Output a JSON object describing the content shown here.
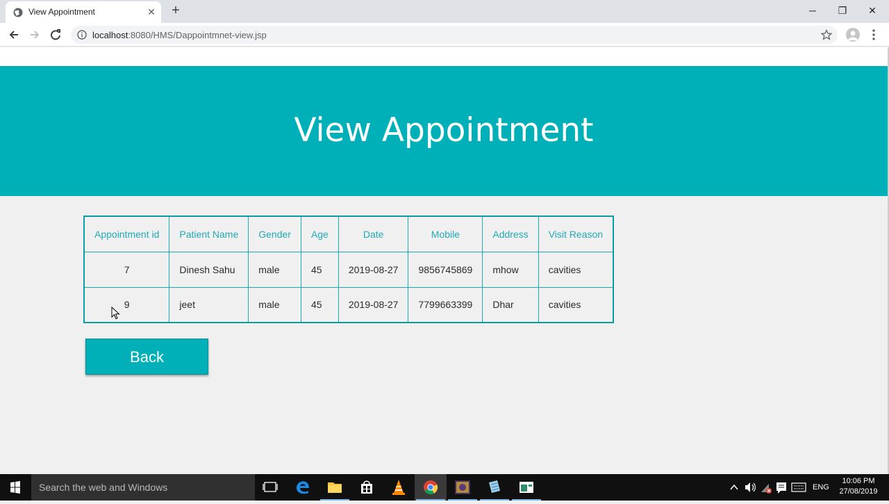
{
  "browser": {
    "tab_title": "View Appointment",
    "url_host": "localhost",
    "url_rest": ":8080/HMS/Dappointmnet-view.jsp"
  },
  "page": {
    "title": "View Appointment",
    "table": {
      "headers": [
        "Appointment id",
        "Patient Name",
        "Gender",
        "Age",
        "Date",
        "Mobile",
        "Address",
        "Visit Reason"
      ],
      "rows": [
        [
          "7",
          "Dinesh Sahu",
          "male",
          "45",
          "2019-08-27",
          "9856745869",
          "mhow",
          "cavities"
        ],
        [
          "9",
          "jeet",
          "male",
          "45",
          "2019-08-27",
          "7799663399",
          "Dhar",
          "cavities"
        ]
      ]
    },
    "back_label": "Back",
    "accent_color": "#00b0b9"
  },
  "taskbar": {
    "search_placeholder": "Search the web and Windows",
    "language": "ENG",
    "time": "10:06 PM",
    "date": "27/08/2019"
  }
}
